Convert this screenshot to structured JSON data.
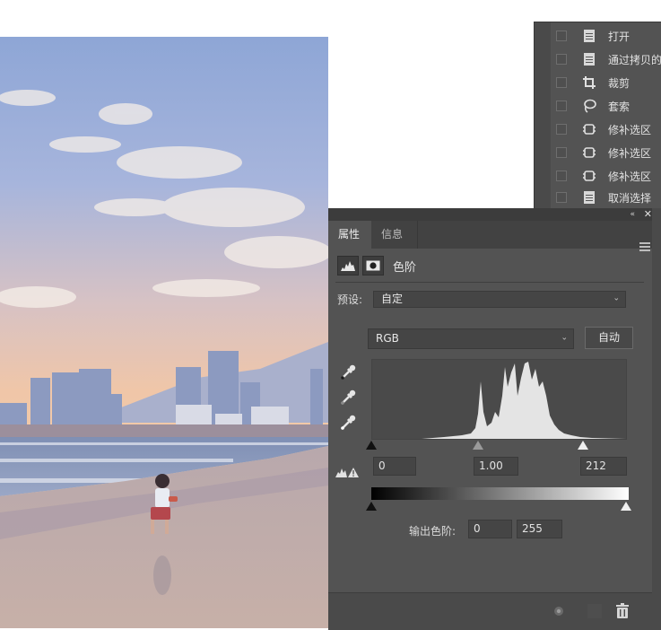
{
  "history": {
    "items": [
      {
        "label": "打开",
        "icon": "document-icon"
      },
      {
        "label": "通过拷贝的",
        "icon": "document-icon"
      },
      {
        "label": "裁剪",
        "icon": "crop-icon"
      },
      {
        "label": "套索",
        "icon": "lasso-icon"
      },
      {
        "label": "修补选区",
        "icon": "patch-icon"
      },
      {
        "label": "修补选区",
        "icon": "patch-icon"
      },
      {
        "label": "修补选区",
        "icon": "patch-icon"
      },
      {
        "label": "取消选择",
        "icon": "document-icon"
      }
    ]
  },
  "properties": {
    "collapse_glyph": "«",
    "close_glyph": "✕",
    "tabs": [
      {
        "label": "属性",
        "active": true
      },
      {
        "label": "信息",
        "active": false
      }
    ],
    "adjustment_title": "色阶",
    "preset_label": "预设:",
    "preset_value": "自定",
    "channel_value": "RGB",
    "auto_label": "自动",
    "input_black": "0",
    "input_gamma": "1.00",
    "input_white": "212",
    "output_label": "输出色阶:",
    "output_black": "0",
    "output_white": "255"
  },
  "colors": {
    "panel_bg": "#535353",
    "panel_dark": "#424242",
    "field_bg": "#454545",
    "text": "#e6e6e6"
  }
}
